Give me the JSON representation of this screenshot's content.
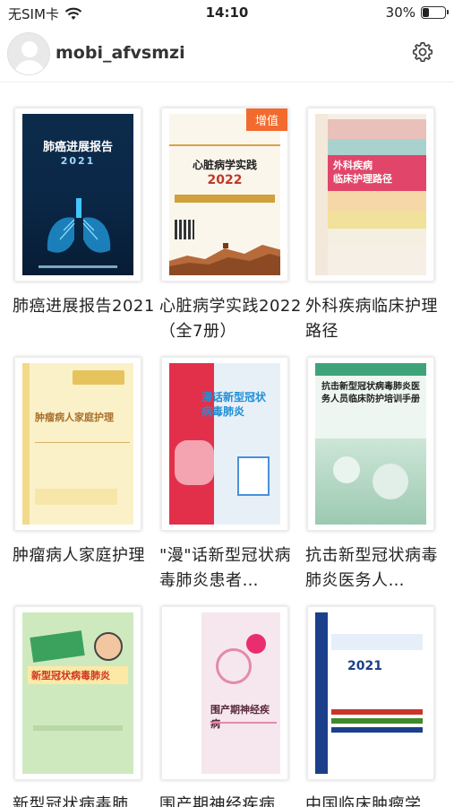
{
  "status": {
    "carrier": "无SIM卡",
    "time": "14:10",
    "battery": "30%",
    "battery_level": 0.3
  },
  "header": {
    "username": "mobi_afvsmzi"
  },
  "books": [
    {
      "title": "肺癌进展报告2021",
      "cover_title": "肺癌进展报告",
      "cover_year": "2021"
    },
    {
      "title": "心脏病学实践2022（全7册）",
      "cover_title": "心脏病学实践",
      "cover_year": "2022",
      "badge": "增值"
    },
    {
      "title": "外科疾病临床护理路径",
      "cover_title": "外科疾病\n临床护理路径"
    },
    {
      "title": "肿瘤病人家庭护理",
      "cover_title": "肿瘤病人家庭护理"
    },
    {
      "title": "\"漫\"话新型冠状病毒肺炎患者…",
      "cover_title": "漫话新型冠状病毒肺炎"
    },
    {
      "title": "抗击新型冠状病毒肺炎医务人…",
      "cover_title": "抗击新型冠状病毒肺炎医务人员临床防护培训手册"
    },
    {
      "title": "新型冠状病毒肺…",
      "cover_title": "新型冠状病毒肺炎"
    },
    {
      "title": "围产期神经疾病…",
      "cover_title": "围产期神经疾病"
    },
    {
      "title": "中国临床肿瘤学…",
      "cover_title": "2021"
    }
  ]
}
